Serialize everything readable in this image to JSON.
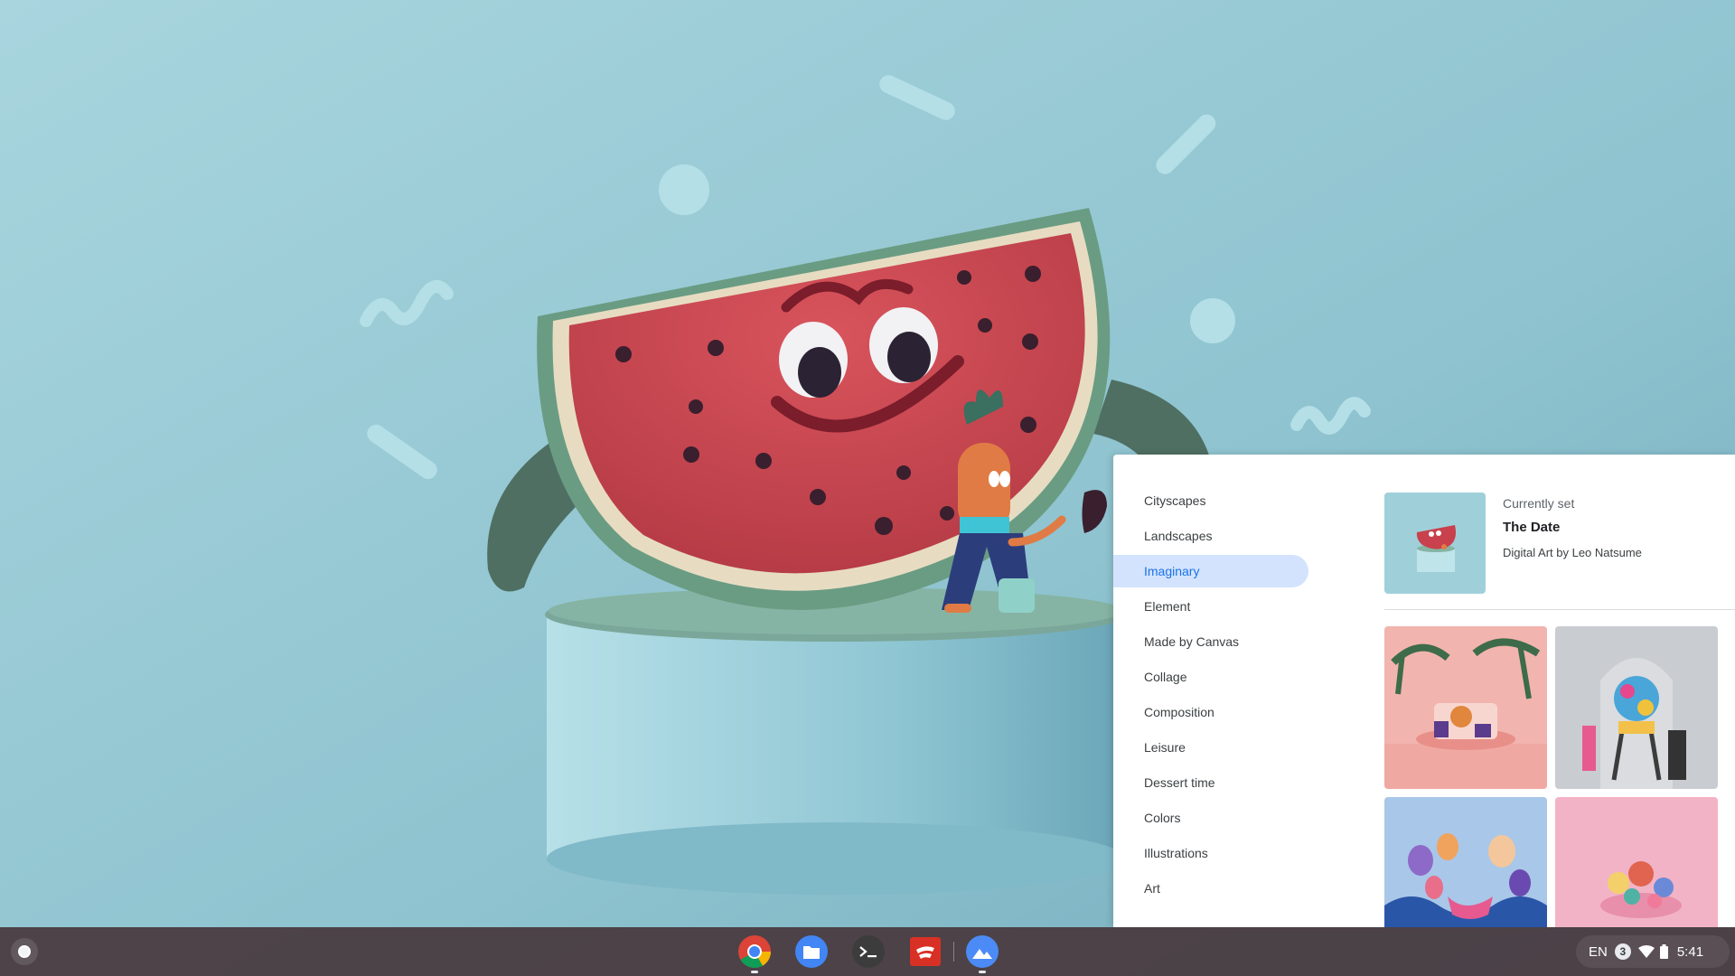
{
  "wallpaper_app": {
    "collections": [
      {
        "label": "Cityscapes",
        "selected": false
      },
      {
        "label": "Landscapes",
        "selected": false
      },
      {
        "label": "Imaginary",
        "selected": true
      },
      {
        "label": "Element",
        "selected": false
      },
      {
        "label": "Made by Canvas",
        "selected": false
      },
      {
        "label": "Collage",
        "selected": false
      },
      {
        "label": "Composition",
        "selected": false
      },
      {
        "label": "Leisure",
        "selected": false
      },
      {
        "label": "Dessert time",
        "selected": false
      },
      {
        "label": "Colors",
        "selected": false
      },
      {
        "label": "Illustrations",
        "selected": false
      },
      {
        "label": "Art",
        "selected": false
      }
    ],
    "current": {
      "label": "Currently set",
      "title": "The Date",
      "artist": "Digital Art by Leo Natsume"
    },
    "accent_color": "#1a73e8",
    "selected_bg_color": "#d3e3fd"
  },
  "shelf": {
    "apps": [
      {
        "name": "chrome-icon",
        "running": true
      },
      {
        "name": "files-icon",
        "running": false
      },
      {
        "name": "terminal-icon",
        "running": false
      },
      {
        "name": "stadia-icon",
        "running": false
      },
      {
        "name": "wallpaper-app-icon",
        "running": true
      }
    ],
    "tray": {
      "ime": "EN",
      "notifications": "3",
      "time": "5:41"
    }
  }
}
